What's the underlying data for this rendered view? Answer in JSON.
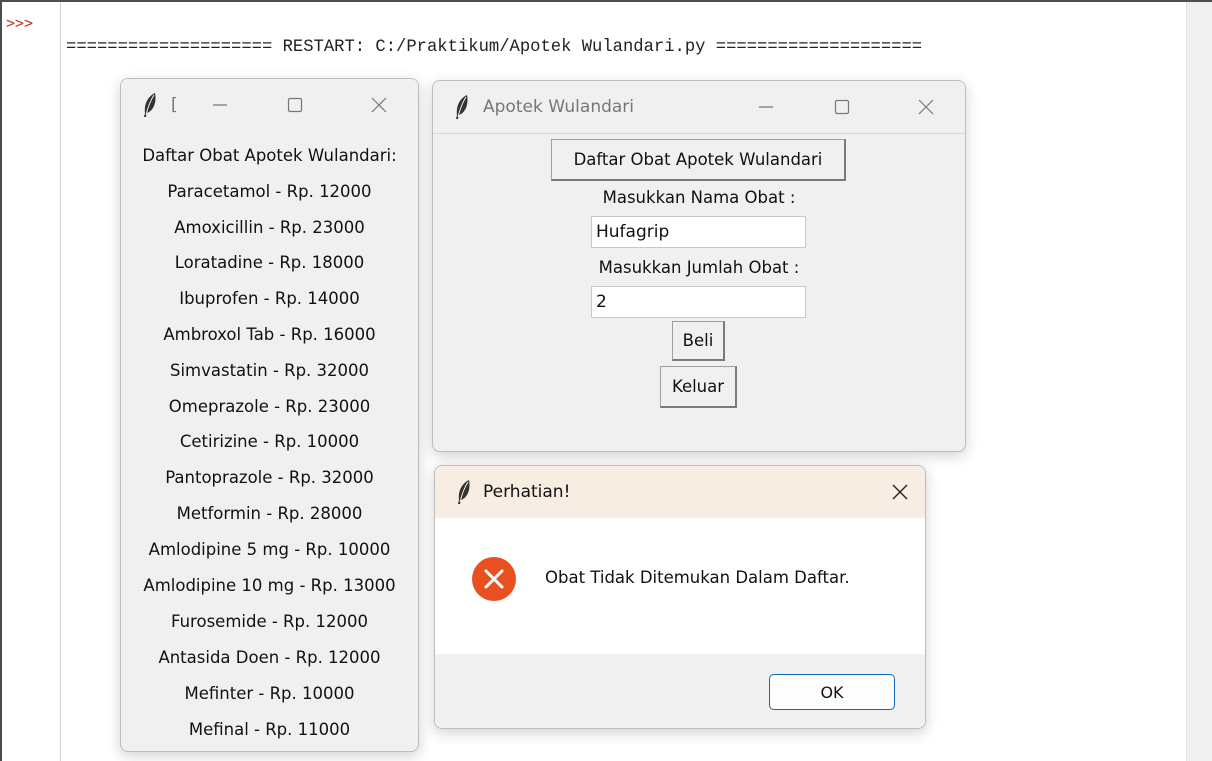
{
  "shell": {
    "prompt": ">>>",
    "restart_line": "==================== RESTART: C:/Praktikum/Apotek Wulandari.py ===================="
  },
  "list_window": {
    "title": "[",
    "heading": "Daftar Obat Apotek Wulandari:",
    "items": [
      "Paracetamol - Rp. 12000",
      "Amoxicillin - Rp. 23000",
      "Loratadine - Rp. 18000",
      "Ibuprofen - Rp. 14000",
      "Ambroxol Tab - Rp. 16000",
      "Simvastatin - Rp. 32000",
      "Omeprazole - Rp. 23000",
      "Cetirizine - Rp. 10000",
      "Pantoprazole - Rp. 32000",
      "Metformin - Rp. 28000",
      "Amlodipine 5 mg - Rp. 10000",
      "Amlodipine 10 mg - Rp. 13000",
      "Furosemide - Rp. 12000",
      "Antasida Doen - Rp. 12000",
      "Mefinter - Rp. 10000",
      "Mefinal - Rp. 11000"
    ]
  },
  "main_window": {
    "title": "Apotek Wulandari",
    "list_button": "Daftar Obat Apotek Wulandari",
    "name_label": "Masukkan Nama Obat :",
    "name_value": "Hufagrip",
    "qty_label": "Masukkan Jumlah Obat :",
    "qty_value": "2",
    "buy_button": "Beli",
    "exit_button": "Keluar"
  },
  "dialog": {
    "title": "Perhatian!",
    "message": "Obat Tidak Ditemukan Dalam Daftar.",
    "ok_button": "OK"
  },
  "colors": {
    "error_icon": "#e8501f",
    "ok_border": "#0f6cbd",
    "dialog_title_bg": "#f8ede3",
    "prompt": "#c0392b"
  },
  "icons": {
    "window_icon": "feather-icon",
    "minimize": "minimize-icon",
    "maximize": "maximize-icon",
    "close": "close-icon",
    "error": "error-icon"
  }
}
